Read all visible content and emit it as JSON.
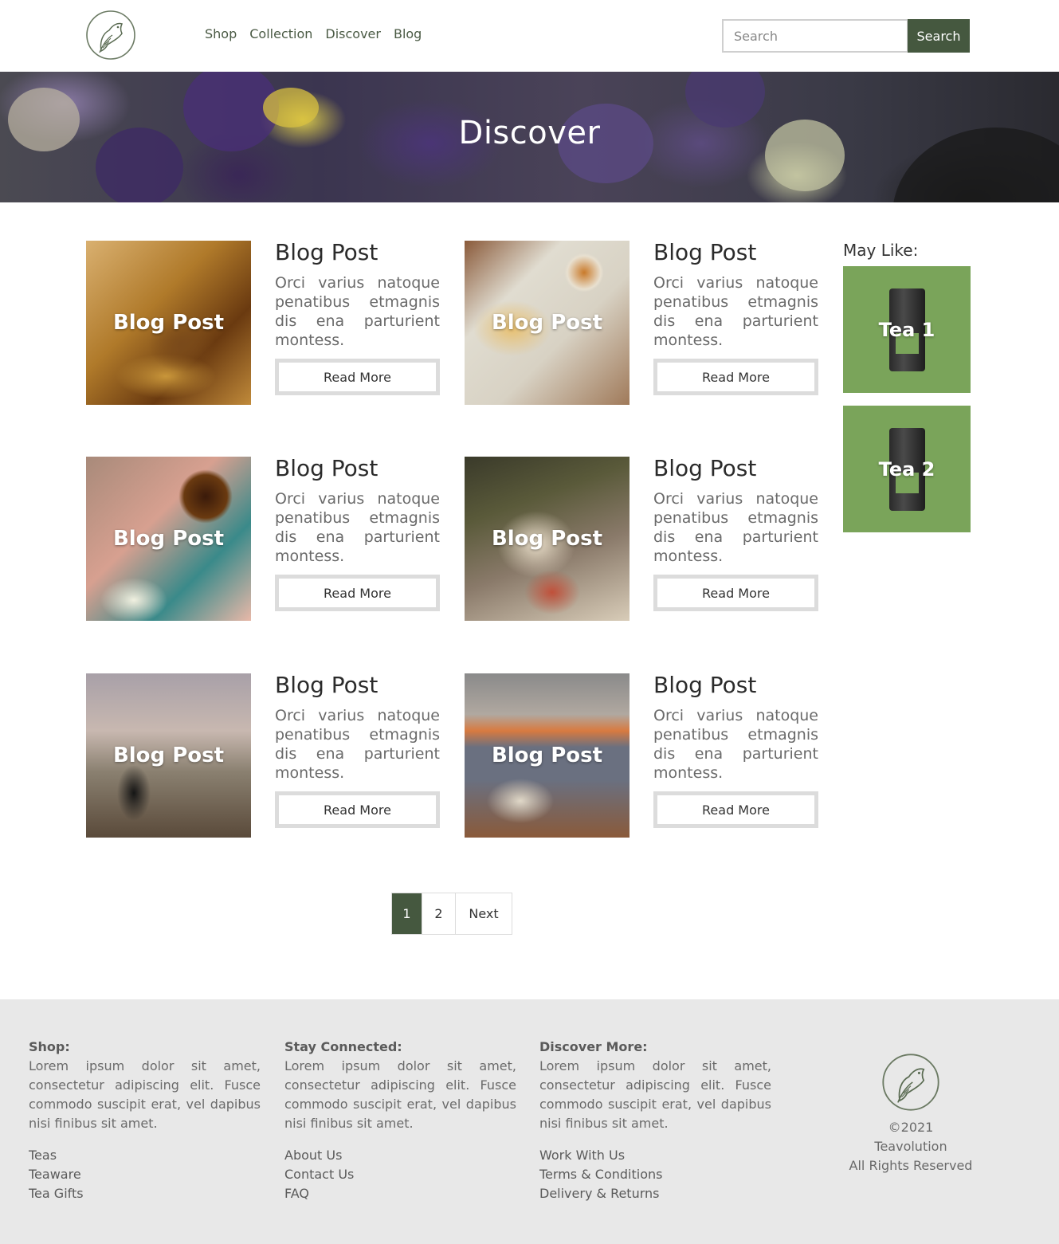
{
  "header": {
    "nav": [
      "Shop",
      "Collection",
      "Discover",
      "Blog"
    ],
    "search_placeholder": "Search",
    "search_button": "Search"
  },
  "hero": {
    "title": "Discover"
  },
  "posts": [
    {
      "overlay": "Blog Post",
      "title": "Blog Post",
      "text": "Orci varius natoque penatibus etmagnis dis ena parturient montess.",
      "button": "Read More"
    },
    {
      "overlay": "Blog Post",
      "title": "Blog Post",
      "text": "Orci varius natoque penatibus etmagnis dis ena parturient montess.",
      "button": "Read More"
    },
    {
      "overlay": "Blog Post",
      "title": "Blog Post",
      "text": "Orci varius natoque penatibus etmagnis dis ena parturient montess.",
      "button": "Read More"
    },
    {
      "overlay": "Blog Post",
      "title": "Blog Post",
      "text": "Orci varius natoque penatibus etmagnis dis ena parturient montess.",
      "button": "Read More"
    },
    {
      "overlay": "Blog Post",
      "title": "Blog Post",
      "text": "Orci varius natoque penatibus etmagnis dis ena parturient montess.",
      "button": "Read More"
    },
    {
      "overlay": "Blog Post",
      "title": "Blog Post",
      "text": "Orci varius natoque penatibus etmagnis dis ena parturient montess.",
      "button": "Read More"
    }
  ],
  "sidebar": {
    "heading": "May Like:",
    "items": [
      {
        "label": "Tea 1"
      },
      {
        "label": "Tea 2"
      }
    ]
  },
  "pagination": {
    "pages": [
      "1",
      "2"
    ],
    "next": "Next",
    "active": "1"
  },
  "footer": {
    "columns": [
      {
        "heading": "Shop:",
        "text": "Lorem ipsum dolor sit amet, consectetur adipiscing elit. Fusce commodo suscipit erat, vel dapibus nisi finibus sit amet.",
        "links": [
          "Teas",
          "Teaware",
          "Tea Gifts"
        ]
      },
      {
        "heading": "Stay Connected:",
        "text": "Lorem ipsum dolor sit amet, consectetur adipiscing elit. Fusce commodo suscipit erat, vel dapibus nisi finibus sit amet.",
        "links": [
          "About Us",
          "Contact Us",
          "FAQ"
        ]
      },
      {
        "heading": "Discover More:",
        "text": "Lorem ipsum dolor sit amet, consectetur adipiscing elit. Fusce commodo suscipit erat, vel dapibus nisi finibus sit amet.",
        "links": [
          "Work With Us",
          "Terms & Conditions",
          "Delivery & Returns"
        ]
      }
    ],
    "copyright": "©2021",
    "company": "Teavolution",
    "rights": "All Rights Reserved"
  },
  "colors": {
    "accent": "#45583f",
    "tea_card": "#7aa45a",
    "footer_bg": "#e8e8e8"
  },
  "icons": {
    "logo": "bird-leaf-logo-icon"
  }
}
